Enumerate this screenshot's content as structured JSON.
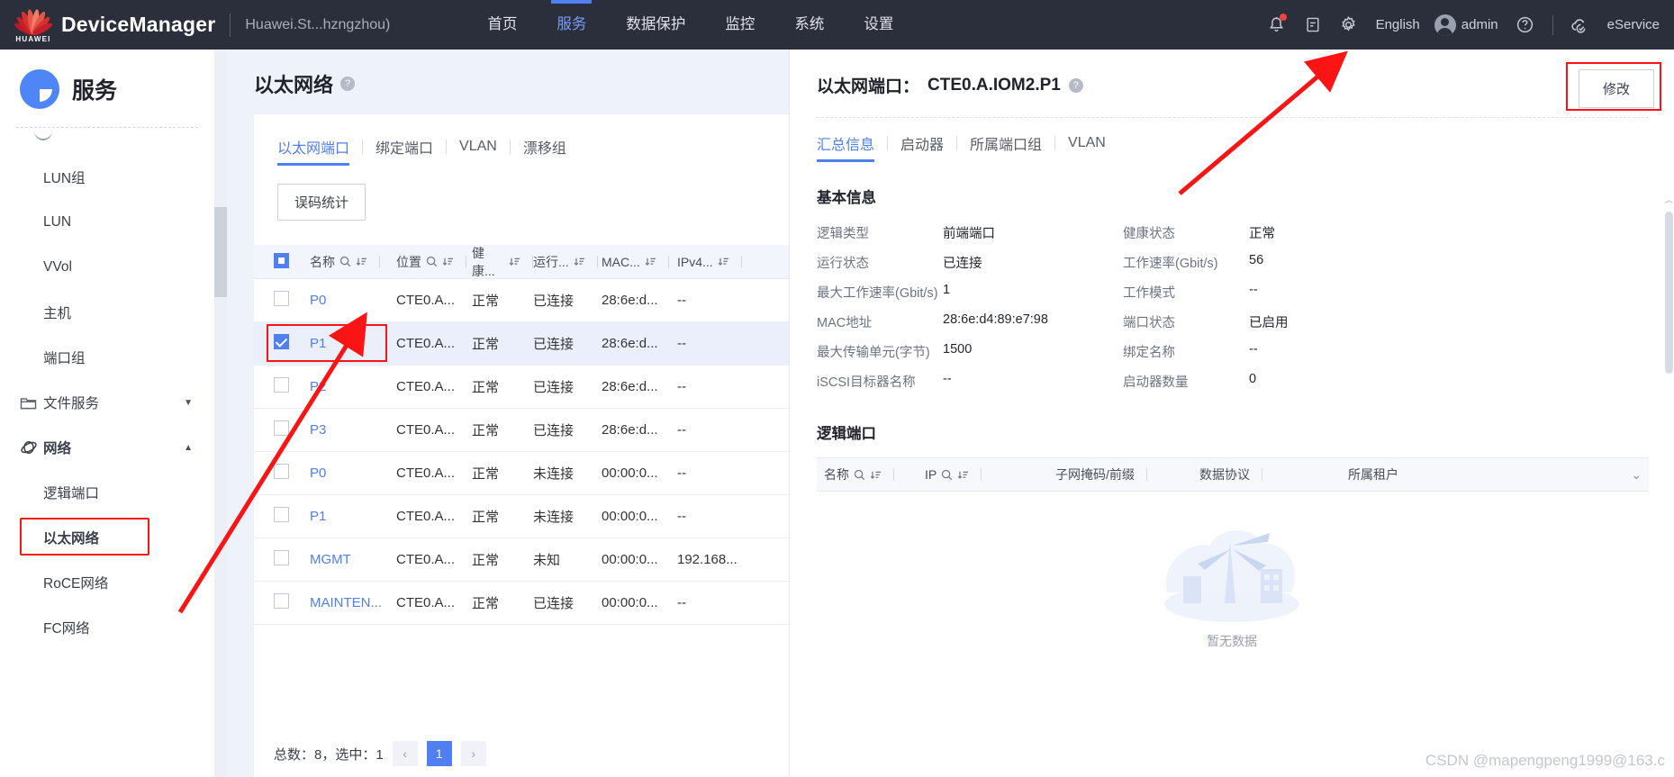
{
  "topbar": {
    "brand": "DeviceManager",
    "huawei_word": "HUAWEI",
    "device_name": "Huawei.St...hzngzhou)",
    "nav": [
      {
        "label": "首页",
        "active": false
      },
      {
        "label": "服务",
        "active": true
      },
      {
        "label": "数据保护",
        "active": false
      },
      {
        "label": "监控",
        "active": false
      },
      {
        "label": "系统",
        "active": false
      },
      {
        "label": "设置",
        "active": false
      }
    ],
    "language": "English",
    "user": "admin",
    "eservice": "eService",
    "icons": [
      "bell-icon",
      "document-icon",
      "gear-icon",
      "help-icon",
      "cloud-icon"
    ]
  },
  "sidebar": {
    "title": "服务",
    "items": [
      {
        "label": "LUN组",
        "type": "child"
      },
      {
        "label": "LUN",
        "type": "child"
      },
      {
        "label": "VVol",
        "type": "child"
      },
      {
        "label": "主机",
        "type": "child"
      },
      {
        "label": "端口组",
        "type": "child"
      },
      {
        "label": "文件服务",
        "type": "group",
        "icon": "folder-icon",
        "caret": "▼"
      },
      {
        "label": "网络",
        "type": "group",
        "icon": "network-icon",
        "caret": "▲",
        "bold": true
      },
      {
        "label": "逻辑端口",
        "type": "child"
      },
      {
        "label": "以太网络",
        "type": "child",
        "highlighted": true,
        "bold": true
      },
      {
        "label": "RoCE网络",
        "type": "child"
      },
      {
        "label": "FC网络",
        "type": "child"
      }
    ]
  },
  "center": {
    "title": "以太网络",
    "tabs": [
      {
        "label": "以太网端口",
        "active": true
      },
      {
        "label": "绑定端口",
        "active": false
      },
      {
        "label": "VLAN",
        "active": false
      },
      {
        "label": "漂移组",
        "active": false
      }
    ],
    "action_button": "误码统计",
    "table": {
      "headers": [
        "名称",
        "位置",
        "健康...",
        "运行...",
        "MAC...",
        "IPv4..."
      ],
      "rows": [
        {
          "checked": false,
          "name": "P0",
          "location": "CTE0.A...",
          "health": "正常",
          "running": "已连接",
          "mac": "28:6e:d...",
          "ipv4": "--"
        },
        {
          "checked": true,
          "name": "P1",
          "location": "CTE0.A...",
          "health": "正常",
          "running": "已连接",
          "mac": "28:6e:d...",
          "ipv4": "--",
          "highlighted": true
        },
        {
          "checked": false,
          "name": "P2",
          "location": "CTE0.A...",
          "health": "正常",
          "running": "已连接",
          "mac": "28:6e:d...",
          "ipv4": "--"
        },
        {
          "checked": false,
          "name": "P3",
          "location": "CTE0.A...",
          "health": "正常",
          "running": "已连接",
          "mac": "28:6e:d...",
          "ipv4": "--"
        },
        {
          "checked": false,
          "name": "P0",
          "location": "CTE0.A...",
          "health": "正常",
          "running": "未连接",
          "mac": "00:00:0...",
          "ipv4": "--"
        },
        {
          "checked": false,
          "name": "P1",
          "location": "CTE0.A...",
          "health": "正常",
          "running": "未连接",
          "mac": "00:00:0...",
          "ipv4": "--"
        },
        {
          "checked": false,
          "name": "MGMT",
          "location": "CTE0.A...",
          "health": "正常",
          "running": "未知",
          "mac": "00:00:0...",
          "ipv4": "192.168..."
        },
        {
          "checked": false,
          "name": "MAINTEN...",
          "location": "CTE0.A...",
          "health": "正常",
          "running": "已连接",
          "mac": "00:00:0...",
          "ipv4": "--"
        }
      ]
    },
    "pager": {
      "summary": "总数：8，选中：1",
      "prev": "‹",
      "page": "1",
      "next": "›"
    }
  },
  "detail": {
    "title_prefix": "以太网端口：",
    "title_value": "CTE0.A.IOM2.P1",
    "modify_button": "修改",
    "tabs": [
      {
        "label": "汇总信息",
        "active": true
      },
      {
        "label": "启动器",
        "active": false
      },
      {
        "label": "所属端口组",
        "active": false
      },
      {
        "label": "VLAN",
        "active": false
      }
    ],
    "basic_section": "基本信息",
    "fields": [
      {
        "key": "逻辑类型",
        "val": "前端端口",
        "key2": "健康状态",
        "val2": "正常"
      },
      {
        "key": "运行状态",
        "val": "已连接",
        "key2": "工作速率(Gbit/s)",
        "val2": "56"
      },
      {
        "key": "最大工作速率(Gbit/s)",
        "val": "1",
        "key2": "工作模式",
        "val2": "--"
      },
      {
        "key": "MAC地址",
        "val": "28:6e:d4:89:e7:98",
        "key2": "端口状态",
        "val2": "已启用"
      },
      {
        "key": "最大传输单元(字节)",
        "val": "1500",
        "key2": "绑定名称",
        "val2": "--"
      },
      {
        "key": "iSCSI目标器名称",
        "val": "--",
        "key2": "启动器数量",
        "val2": "0"
      }
    ],
    "logical_section": "逻辑端口",
    "logical_headers": [
      "名称",
      "IP",
      "子网掩码/前缀",
      "数据协议",
      "所属租户"
    ],
    "empty_text": "暂无数据"
  },
  "watermark": "CSDN @mapengpeng1999@163.c"
}
